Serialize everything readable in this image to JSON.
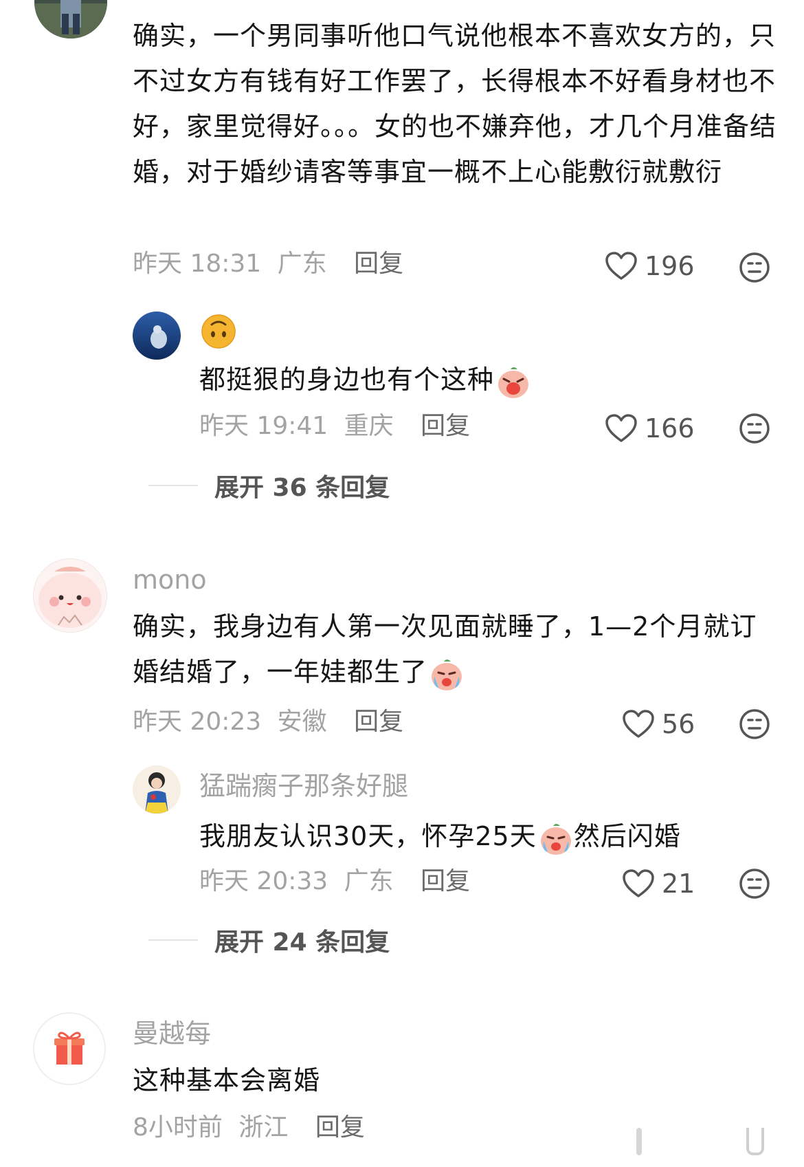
{
  "comments": [
    {
      "username": "",
      "text": "确实，一个男同事听他口气说他根本不喜欢女方的，只不过女方有钱有好工作罢了，长得根本不好看身材也不好，家里觉得好。。。女的也不嫌弃他，才几个月准备结婚，对于婚纱请客等事宜一概不上心能敷衍就敷衍",
      "time": "昨天 18:31",
      "location": "广东",
      "reply_label": "回复",
      "likes": "196",
      "replies": [
        {
          "username_emoji": "🙃",
          "text": "都挺狠的身边也有个这种",
          "time": "昨天 19:41",
          "location": "重庆",
          "reply_label": "回复",
          "likes": "166"
        }
      ],
      "expand_label": "展开 36 条回复"
    },
    {
      "username": "mono",
      "text": "确实，我身边有人第一次见面就睡了，1—2个月就订婚结婚了，一年娃都生了",
      "time": "昨天 20:23",
      "location": "安徽",
      "reply_label": "回复",
      "likes": "56",
      "replies": [
        {
          "username": "猛踹瘸子那条好腿",
          "text_before": "我朋友认识30天，怀孕25天",
          "text_after": "然后闪婚",
          "time": "昨天 20:33",
          "location": "广东",
          "reply_label": "回复",
          "likes": "21"
        }
      ],
      "expand_label": "展开 24 条回复"
    },
    {
      "username": "曼越每",
      "text": "这种基本会离婚",
      "time": "8小时前",
      "location": "浙江",
      "reply_label": "回复"
    }
  ],
  "icons": {
    "like": "heart-outline-icon",
    "more": "neutral-face-icon",
    "gift": "gift-icon"
  },
  "colors": {
    "text": "#161616",
    "meta": "#a3a3a3",
    "reply_button": "#6b6b6b",
    "count": "#555555"
  }
}
